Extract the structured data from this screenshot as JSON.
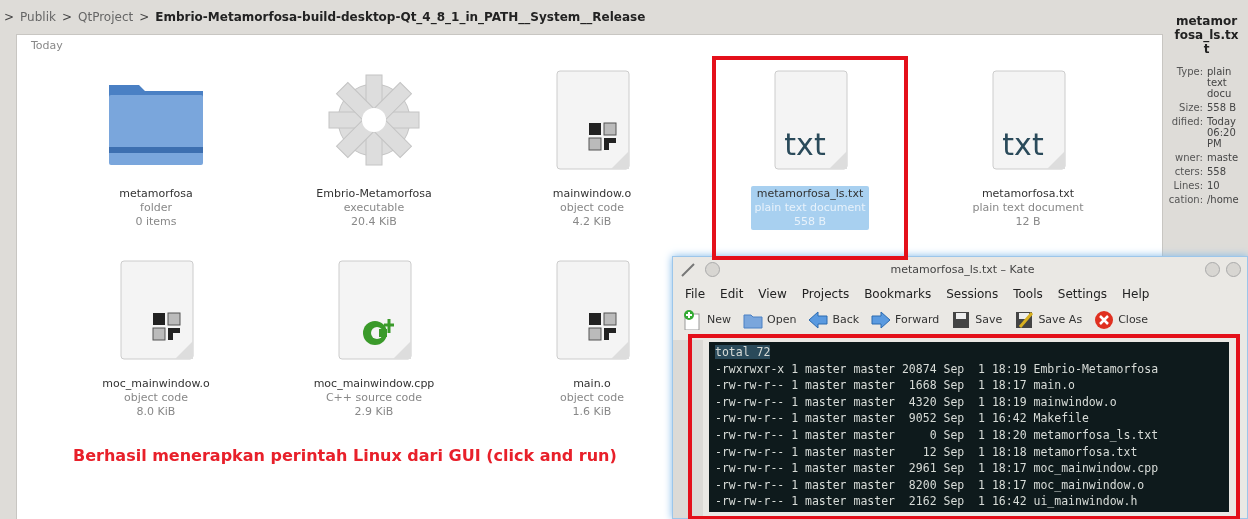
{
  "breadcrumb": {
    "separator": ">",
    "items": [
      {
        "label": "Publik",
        "current": false
      },
      {
        "label": "QtProject",
        "current": false
      },
      {
        "label": "Embrio-Metamorfosa-build-desktop-Qt_4_8_1_in_PATH__System__Release",
        "current": true
      }
    ]
  },
  "view": {
    "group": "Today",
    "files": [
      {
        "name": "metamorfosa",
        "type": "folder",
        "size": "0 items",
        "kind": "folder",
        "selected": false
      },
      {
        "name": "Embrio-Metamorfosa",
        "type": "executable",
        "size": "20.4 KiB",
        "kind": "executable",
        "selected": false
      },
      {
        "name": "mainwindow.o",
        "type": "object code",
        "size": "4.2 KiB",
        "kind": "object",
        "selected": false
      },
      {
        "name": "metamorfosa_ls.txt",
        "type": "plain text document",
        "size": "558 B",
        "kind": "text",
        "icon_text": "txt",
        "selected": true
      },
      {
        "name": "metamorfosa.txt",
        "type": "plain text document",
        "size": "12 B",
        "kind": "text",
        "icon_text": "txt",
        "selected": false
      },
      {
        "name": "moc_mainwindow.o",
        "type": "object code",
        "size": "8.0 KiB",
        "kind": "object",
        "selected": false
      },
      {
        "name": "moc_mainwindow.cpp",
        "type": "C++ source code",
        "size": "2.9 KiB",
        "kind": "cpp",
        "selected": false
      },
      {
        "name": "main.o",
        "type": "object code",
        "size": "1.6 KiB",
        "kind": "object",
        "selected": false
      }
    ]
  },
  "info_panel": {
    "title": "metamorfosa_ls.txt",
    "properties": [
      {
        "label": "Type:",
        "value": "plain text docu"
      },
      {
        "label": "Size:",
        "value": "558 B"
      },
      {
        "label": "dified:",
        "value": "Today 06:20 PM"
      },
      {
        "label": "wner:",
        "value": "maste"
      },
      {
        "label": "cters:",
        "value": "558"
      },
      {
        "label": "Lines:",
        "value": "10"
      },
      {
        "label": "cation:",
        "value": "/home"
      }
    ]
  },
  "caption": "Berhasil menerapkan perintah Linux dari GUI (click and run)",
  "kate": {
    "title": "metamorfosa_ls.txt – Kate",
    "menu": [
      "File",
      "Edit",
      "View",
      "Projects",
      "Bookmarks",
      "Sessions",
      "Tools",
      "Settings",
      "Help"
    ],
    "toolbar": [
      {
        "label": "New",
        "kind": "new"
      },
      {
        "label": "Open",
        "kind": "open"
      },
      {
        "label": "Back",
        "kind": "back"
      },
      {
        "label": "Forward",
        "kind": "forward"
      },
      {
        "label": "Save",
        "kind": "save"
      },
      {
        "label": "Save As",
        "kind": "saveas"
      },
      {
        "label": "Close",
        "kind": "close"
      }
    ],
    "lines": [
      {
        "text": "total 72",
        "selected": true
      },
      {
        "text": "-rwxrwxr-x 1 master master 20874 Sep  1 18:19 Embrio-Metamorfosa",
        "selected": false
      },
      {
        "text": "-rw-rw-r-- 1 master master  1668 Sep  1 18:17 main.o",
        "selected": false
      },
      {
        "text": "-rw-rw-r-- 1 master master  4320 Sep  1 18:19 mainwindow.o",
        "selected": false
      },
      {
        "text": "-rw-rw-r-- 1 master master  9052 Sep  1 16:42 Makefile",
        "selected": false
      },
      {
        "text": "-rw-rw-r-- 1 master master     0 Sep  1 18:20 metamorfosa_ls.txt",
        "selected": false
      },
      {
        "text": "-rw-rw-r-- 1 master master    12 Sep  1 18:18 metamorfosa.txt",
        "selected": false
      },
      {
        "text": "-rw-rw-r-- 1 master master  2961 Sep  1 18:17 moc_mainwindow.cpp",
        "selected": false
      },
      {
        "text": "-rw-rw-r-- 1 master master  8200 Sep  1 18:17 moc_mainwindow.o",
        "selected": false
      },
      {
        "text": "-rw-rw-r-- 1 master master  2162 Sep  1 16:42 ui_mainwindow.h",
        "selected": false
      }
    ]
  }
}
